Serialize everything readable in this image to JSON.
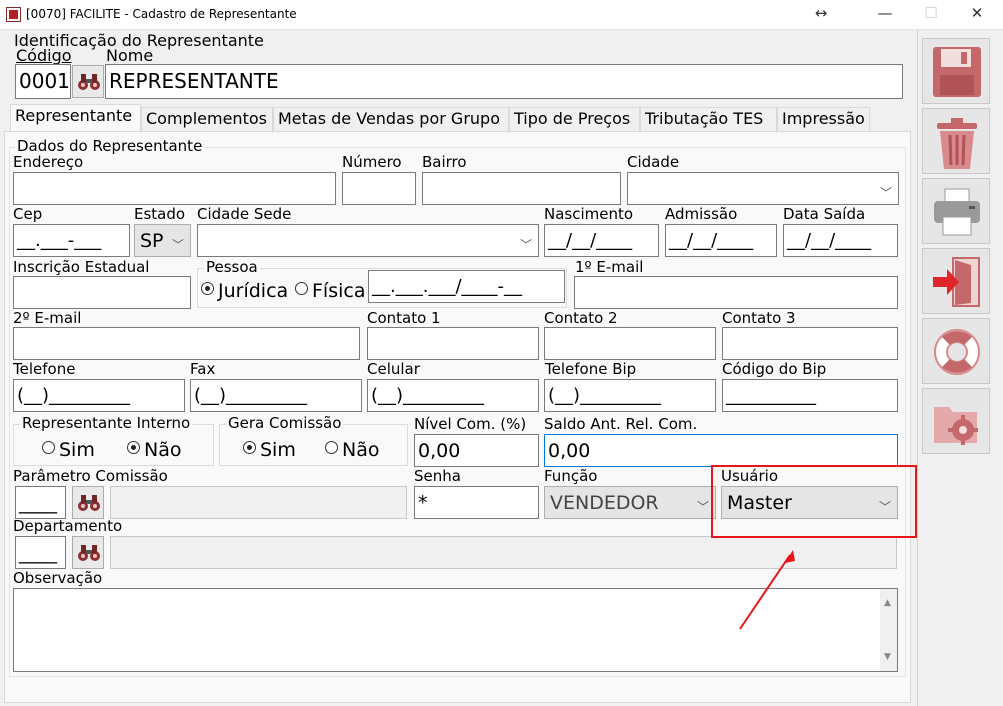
{
  "window": {
    "title": "[0070] FACILITE - Cadastro de Representante",
    "restore": "↔",
    "minimize": "—",
    "maximize": "☐",
    "close": "✕"
  },
  "header": {
    "group_label": "Identificação do Representante",
    "codigo_label": "Código",
    "codigo_value": "0001",
    "nome_label": "Nome",
    "nome_value": "REPRESENTANTE"
  },
  "tabs": [
    {
      "label": "Representante"
    },
    {
      "label": "Complementos"
    },
    {
      "label": "Metas de Vendas por Grupo"
    },
    {
      "label": "Tipo de Preços"
    },
    {
      "label": "Tributação TES"
    },
    {
      "label": "Impressão"
    }
  ],
  "form": {
    "group_label": "Dados do Representante",
    "endereco_label": "Endereço",
    "numero_label": "Número",
    "bairro_label": "Bairro",
    "cidade_label": "Cidade",
    "cep_label": "Cep",
    "cep_value": "__.___-___",
    "estado_label": "Estado",
    "estado_value": "SP",
    "cidade_sede_label": "Cidade Sede",
    "nascimento_label": "Nascimento",
    "nascimento_value": "__/__/____",
    "admissao_label": "Admissão",
    "admissao_value": "__/__/____",
    "data_saida_label": "Data Saída",
    "data_saida_value": "__/__/____",
    "inscricao_label": "Inscrição Estadual",
    "pessoa_label": "Pessoa",
    "juridica_label": "Jurídica",
    "fisica_label": "Física",
    "cnpj_value": "__.___.___/____-__",
    "email1_label": "1º E-mail",
    "email2_label": "2º E-mail",
    "contato1_label": "Contato 1",
    "contato2_label": "Contato 2",
    "contato3_label": "Contato 3",
    "telefone_label": "Telefone",
    "telefone_value": "(__)_________",
    "fax_label": "Fax",
    "fax_value": "(__)_________",
    "celular_label": "Celular",
    "celular_value": "(__)_________",
    "telefone_bip_label": "Telefone Bip",
    "telefone_bip_value": "(__)_________",
    "codigo_bip_label": "Código do Bip",
    "codigo_bip_value": "__________",
    "rep_interno_label": "Representante Interno",
    "rep_sim": "Sim",
    "rep_nao": "Não",
    "gera_comissao_label": "Gera Comissão",
    "gera_sim": "Sim",
    "gera_nao": "Não",
    "nivel_label": "Nível Com. (%)",
    "nivel_value": "0,00",
    "saldo_label": "Saldo Ant. Rel. Com.",
    "saldo_value": "0,00",
    "parametro_label": "Parâmetro Comissão",
    "parametro_value": "____",
    "senha_label": "Senha",
    "senha_value": "*",
    "funcao_label": "Função",
    "funcao_value": "VENDEDOR",
    "usuario_label": "Usuário",
    "usuario_value": "Master",
    "departamento_label": "Departamento",
    "departamento_value": "____",
    "observacao_label": "Observação"
  },
  "colors": {
    "highlight": "#e8161b",
    "icon_red": "#c4686c"
  },
  "icons": [
    "save-icon",
    "trash-icon",
    "printer-icon",
    "exit-door-icon",
    "lifebuoy-help-icon",
    "folder-settings-icon",
    "binoculars-icon"
  ]
}
